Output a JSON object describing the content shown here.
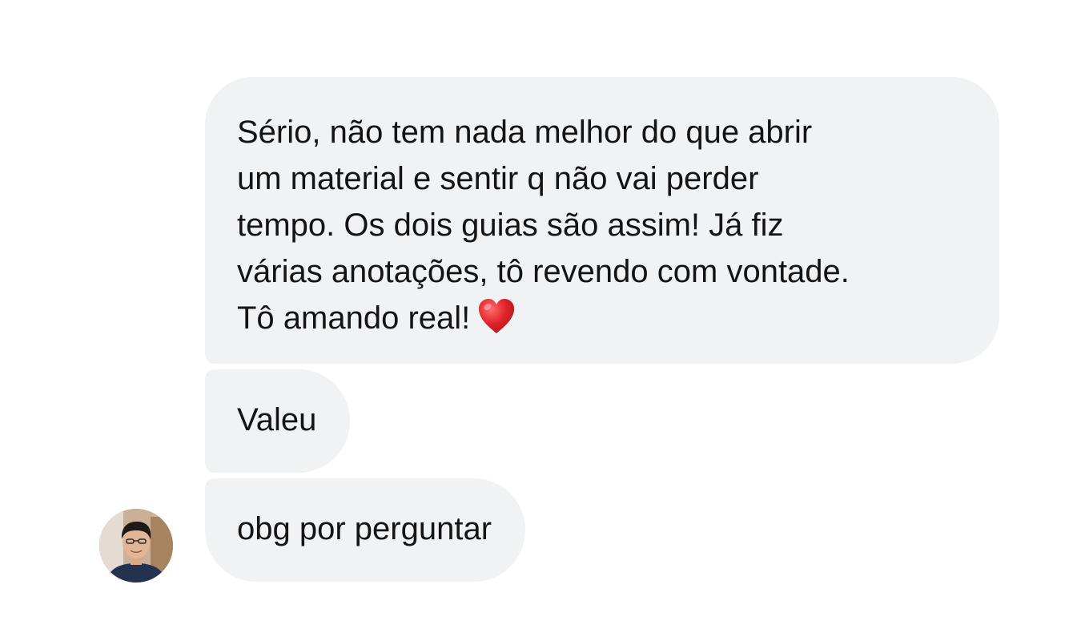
{
  "messages": [
    {
      "lines": [
        "Sério, não tem nada melhor do que abrir",
        "um material e sentir q não vai perder",
        "tempo. Os dois guias são assim! Já fiz",
        "várias anotações, tô revendo com vontade.",
        "Tô amando real!"
      ],
      "emoji": "heart-icon"
    },
    {
      "text": "Valeu"
    },
    {
      "text": "obg por perguntar"
    }
  ],
  "colors": {
    "bubble_background": "#f1f2f4",
    "text": "#141414",
    "heart": "#e0252b"
  }
}
